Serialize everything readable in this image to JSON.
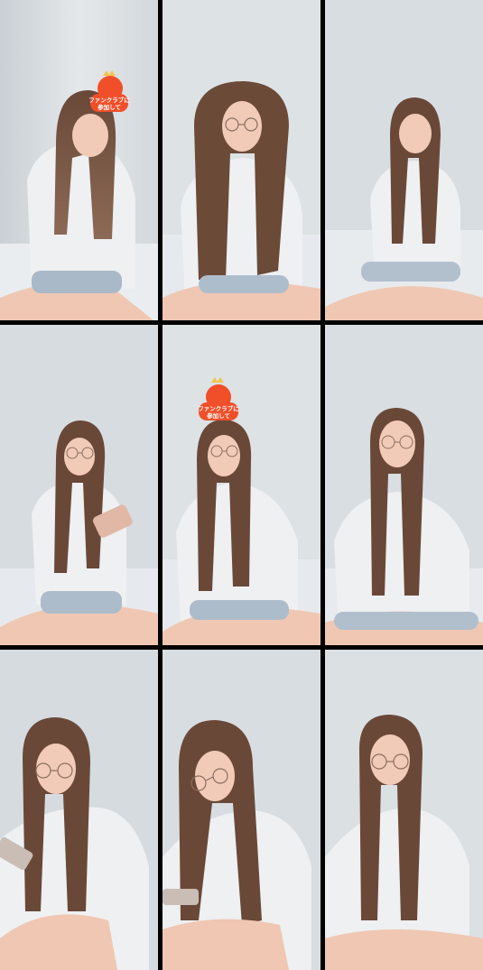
{
  "sticker": {
    "text_line1": "ファンクラブに",
    "text_line2": "参加して"
  },
  "colors": {
    "wall": "#dfe3e6",
    "wall_shadow": "#b9c0c6",
    "shirt": "#eef0f2",
    "hair": "#5a3a2a",
    "skin": "#f1cbb8",
    "sticker_red": "#f04f2a",
    "crown_yellow": "#f6c34a"
  },
  "frames": [
    {
      "id": "r1c1",
      "has_sticker": true
    },
    {
      "id": "r1c2",
      "has_sticker": false
    },
    {
      "id": "r1c3",
      "has_sticker": false
    },
    {
      "id": "r2c1",
      "has_sticker": false
    },
    {
      "id": "r2c2",
      "has_sticker": true
    },
    {
      "id": "r2c3",
      "has_sticker": false
    },
    {
      "id": "r3c1",
      "has_sticker": false
    },
    {
      "id": "r3c2",
      "has_sticker": false
    },
    {
      "id": "r3c3",
      "has_sticker": false
    }
  ]
}
